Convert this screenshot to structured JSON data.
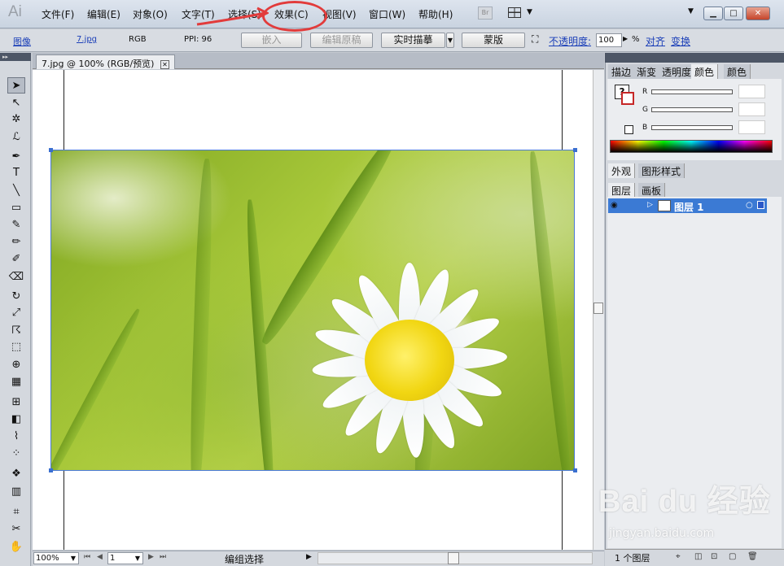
{
  "app": {
    "logo": "Ai"
  },
  "menu": [
    {
      "label": "文件(F)"
    },
    {
      "label": "编辑(E)"
    },
    {
      "label": "对象(O)"
    },
    {
      "label": "文字(T)"
    },
    {
      "label": "选择(S)"
    },
    {
      "label": "效果(C)"
    },
    {
      "label": "视图(V)"
    },
    {
      "label": "窗口(W)"
    },
    {
      "label": "帮助(H)"
    }
  ],
  "bridge_button": "Br",
  "control_bar": {
    "object_type": "图像",
    "file_link": "7.jpg",
    "color_mode": "RGB",
    "ppi": "PPI: 96",
    "embed_button": "嵌入",
    "edit_original_button": "编辑原稿",
    "live_trace_button": "实时描摹",
    "mask_button": "蒙版",
    "opacity_label": "不透明度:",
    "opacity_value": "100",
    "opacity_unit": "%",
    "align_link": "对齐",
    "transform_link": "变换"
  },
  "document": {
    "tab_title": "7.jpg @ 100% (RGB/预览)",
    "close_glyph": "✕"
  },
  "status_bar": {
    "zoom": "100%",
    "page": "1",
    "status_text": "编组选择"
  },
  "right_panel": {
    "tabs_top": [
      "描边",
      "渐变",
      "透明度",
      "颜色",
      "颜色"
    ],
    "color": {
      "r_label": "R",
      "g_label": "G",
      "b_label": "B"
    },
    "tabs_mid": [
      "外观",
      "图形样式"
    ],
    "tabs_layers": [
      "图层",
      "画板"
    ],
    "layer_name": "图层 1",
    "layer_count": "1 个图层"
  },
  "watermark": {
    "brand": "Bai du 经验",
    "url": "jingyan.baidu.com"
  },
  "colors": {
    "accent": "#3b7ad4",
    "annotation_red": "#e23b3b"
  }
}
